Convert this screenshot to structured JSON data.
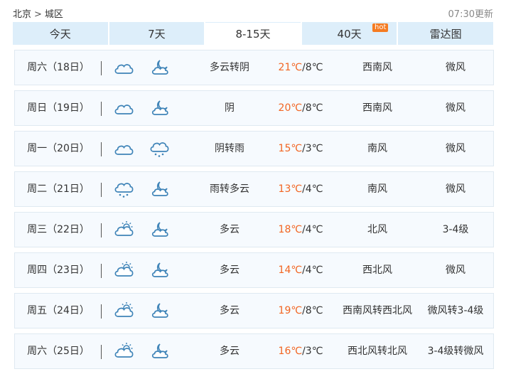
{
  "breadcrumb": {
    "city": "北京",
    "separator": ">",
    "district": "城区"
  },
  "update_time": "07:30更新",
  "tabs": [
    {
      "label": "今天",
      "active": false
    },
    {
      "label": "7天",
      "active": false
    },
    {
      "label": "8-15天",
      "active": true
    },
    {
      "label": "40天",
      "active": false,
      "badge": "hot"
    },
    {
      "label": "雷达图",
      "active": false
    }
  ],
  "forecast": [
    {
      "day": "周六（18日）",
      "icons": [
        "cloudy-icon",
        "moon-cloud-icon"
      ],
      "weather": "多云转阴",
      "high": "21℃",
      "low": "/8℃",
      "wind": "西南风",
      "level": "微风"
    },
    {
      "day": "周日（19日）",
      "icons": [
        "cloudy-icon",
        "moon-cloud-icon"
      ],
      "weather": "阴",
      "high": "20℃",
      "low": "/8℃",
      "wind": "西南风",
      "level": "微风"
    },
    {
      "day": "周一（20日）",
      "icons": [
        "cloudy-icon",
        "rain-icon"
      ],
      "weather": "阴转雨",
      "high": "15℃",
      "low": "/3℃",
      "wind": "南风",
      "level": "微风"
    },
    {
      "day": "周二（21日）",
      "icons": [
        "rain-icon",
        "moon-cloud-icon"
      ],
      "weather": "雨转多云",
      "high": "13℃",
      "low": "/4℃",
      "wind": "南风",
      "level": "微风"
    },
    {
      "day": "周三（22日）",
      "icons": [
        "sun-cloud-icon",
        "moon-cloud-icon"
      ],
      "weather": "多云",
      "high": "18℃",
      "low": "/4℃",
      "wind": "北风",
      "level": "3-4级"
    },
    {
      "day": "周四（23日）",
      "icons": [
        "sun-cloud-icon",
        "moon-cloud-icon"
      ],
      "weather": "多云",
      "high": "14℃",
      "low": "/4℃",
      "wind": "西北风",
      "level": "微风"
    },
    {
      "day": "周五（24日）",
      "icons": [
        "sun-cloud-icon",
        "moon-cloud-icon"
      ],
      "weather": "多云",
      "high": "19℃",
      "low": "/8℃",
      "wind": "西南风转西北风",
      "level": "微风转3-4级"
    },
    {
      "day": "周六（25日）",
      "icons": [
        "sun-cloud-icon",
        "moon-cloud-icon"
      ],
      "weather": "多云",
      "high": "16℃",
      "low": "/3℃",
      "wind": "西北风转北风",
      "level": "3-4级转微风"
    }
  ],
  "colors": {
    "tab_bg": "#ddeefa",
    "row_bg": "#f6fafe",
    "row_border": "#dfe9f1",
    "high_temp": "#f26522",
    "badge": "#f57b21",
    "icon": "#3f84b8"
  }
}
